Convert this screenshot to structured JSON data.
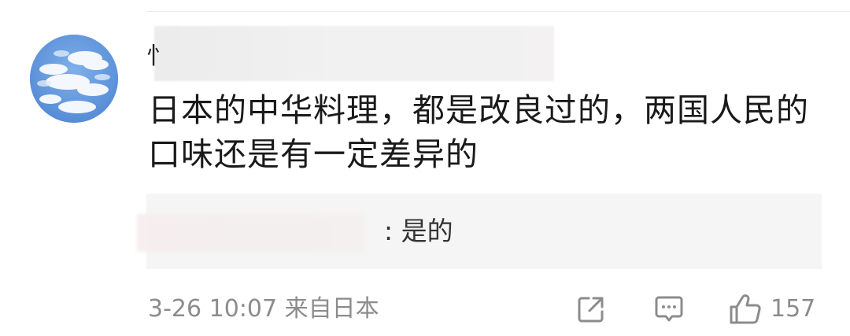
{
  "comment": {
    "username_visible": "忄",
    "text": "日本的中华料理，都是改良过的，两国人民的口味还是有一定差异的",
    "reply": {
      "text": ": 是的"
    },
    "timestamp": "3-26 10:07",
    "location": "来自日本",
    "like_count": "157"
  },
  "icons": {
    "share": "share-icon",
    "reply": "comment-icon",
    "like": "thumbs-up-icon"
  },
  "colors": {
    "text": "#1a1a1a",
    "meta": "#8c8c8c",
    "reply_bg": "#f5f5f5"
  }
}
